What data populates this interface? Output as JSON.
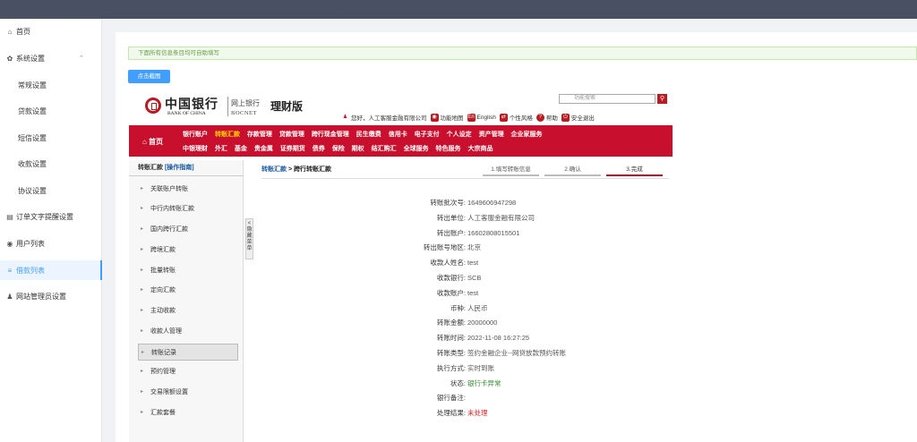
{
  "sidebar": {
    "items": [
      {
        "label": "首页",
        "icon": "home-icon",
        "glyph": "⌂"
      },
      {
        "label": "系统设置",
        "icon": "gear-icon",
        "glyph": "✿",
        "arrow": "⌃"
      },
      {
        "label": "常规设置"
      },
      {
        "label": "贷款设置"
      },
      {
        "label": "短信设置"
      },
      {
        "label": "收款设置"
      },
      {
        "label": "协议设置"
      },
      {
        "label": "订单文字提醒设置",
        "icon": "doc-icon",
        "glyph": "▤"
      },
      {
        "label": "用户列表",
        "icon": "eye-icon",
        "glyph": "◉"
      },
      {
        "label": "借款列表",
        "icon": "list-icon",
        "glyph": "≡"
      },
      {
        "label": "网站管理员设置",
        "icon": "user-icon",
        "glyph": "♟"
      }
    ]
  },
  "main": {
    "alert": "下面所有信息条目均可自助填写",
    "screenshot_button": "点击截图"
  },
  "boc": {
    "logo_cn": "中国银行",
    "logo_en": "BANK OF CHINA",
    "online_bank_cn": "网上银行",
    "online_bank_en": "BOCNET",
    "edition": "理财版",
    "search_placeholder": "功能搜索",
    "search_glyph": "⚲",
    "greeting": "您好，人工客服金融有限公司",
    "links": [
      {
        "label": "功能地图",
        "glyph": "◉"
      },
      {
        "label": "English",
        "glyph": "En"
      },
      {
        "label": "个性风格",
        "glyph": "⇄"
      },
      {
        "label": "帮助",
        "glyph": "?"
      },
      {
        "label": "安全退出",
        "glyph": "⏻"
      }
    ],
    "home": "⌂ 首页",
    "nav_row1": [
      "银行账户",
      "转账汇款",
      "存款管理",
      "贷款管理",
      "跨行现金管理",
      "民生缴费",
      "信用卡",
      "电子支付",
      "个人设定",
      "资产管理",
      "企业家服务"
    ],
    "nav_row2": [
      "中银理财",
      "外汇",
      "基金",
      "贵金属",
      "证券期货",
      "债券",
      "保险",
      "期权",
      "结汇购汇",
      "全球服务",
      "特色服务",
      "大宗商品"
    ],
    "nav_current": "转账汇款",
    "leftnav": {
      "title": "转账汇款",
      "guide": "[操作指南]",
      "items": [
        "关联账户转账",
        "中行内转账汇款",
        "国内跨行汇款",
        "跨境汇款",
        "批量转账",
        "定向汇款",
        "主动收款",
        "收款人管理",
        "转账记录",
        "预约管理",
        "交易限额设置",
        "汇款套餐"
      ],
      "selected": "转账记录"
    },
    "hide_menu": "< 隐藏菜单",
    "breadcrumb": {
      "part1": "转账汇款",
      "sep": " > ",
      "part2": "跨行转账汇款"
    },
    "steps": [
      "1.填写转账信息",
      "2.确认",
      "3.完成"
    ],
    "details": [
      {
        "label": "转账批次号:",
        "value": "1649606947298"
      },
      {
        "label": "转出单位:",
        "value": "人工客服金融有限公司"
      },
      {
        "label": "转出账户:",
        "value": "16602808015501"
      },
      {
        "label": "转出账号地区:",
        "value": "北京"
      },
      {
        "label": "收款人姓名:",
        "value": "test"
      },
      {
        "label": "收款银行:",
        "value": "SCB"
      },
      {
        "label": "收款账户:",
        "value": "test"
      },
      {
        "label": "币种:",
        "value": "人民币"
      },
      {
        "label": "转账金额:",
        "value": "20000000"
      },
      {
        "label": "转账时间:",
        "value": "2022-11-08 16:27:25"
      },
      {
        "label": "转账类型:",
        "value": "签约金融企业--网贷放款预约转账"
      },
      {
        "label": "执行方式:",
        "value": "实时到账"
      },
      {
        "label": "状态:",
        "value": "银行卡异常"
      },
      {
        "label": "银行备注:",
        "value": ""
      },
      {
        "label": "处理结果:",
        "value": "未处理"
      }
    ]
  },
  "colors": {
    "topbar": "#4a5063",
    "active": "#409eff",
    "boc_red": "#c8102e",
    "status_green": "#2b8a2b",
    "result_red": "#e02020"
  }
}
